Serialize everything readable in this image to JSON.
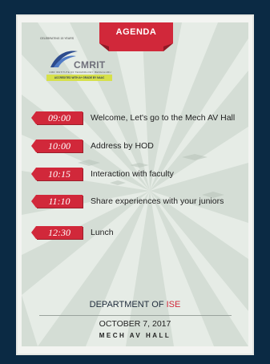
{
  "poster": {
    "banner_title": "AGENDA",
    "logo": {
      "brand": "CMRIT",
      "arc_text": "CELEBRATING 15 YEARS",
      "institute": "CMR INSTITUTE OF TECHNOLOGY, BENGALURU",
      "accreditation": "ACCREDITED WITH A+ GRADE BY NAAC"
    },
    "agenda": [
      {
        "time": "09:00",
        "text": "Welcome, Let's go to the Mech AV Hall"
      },
      {
        "time": "10:00",
        "text": "Address by HOD"
      },
      {
        "time": "10:15",
        "text": "Interaction with faculty"
      },
      {
        "time": "11:10",
        "text": "Share experiences with your juniors"
      },
      {
        "time": "12:30",
        "text": "Lunch"
      }
    ],
    "department_prefix": "DEPARTMENT OF",
    "department_accent": "ISE",
    "date": "OCTOBER 7, 2017",
    "venue": "MECH AV HALL"
  },
  "colors": {
    "background": "#0b2a44",
    "accent": "#d1283a",
    "poster_bg": "#d5ddd6"
  }
}
